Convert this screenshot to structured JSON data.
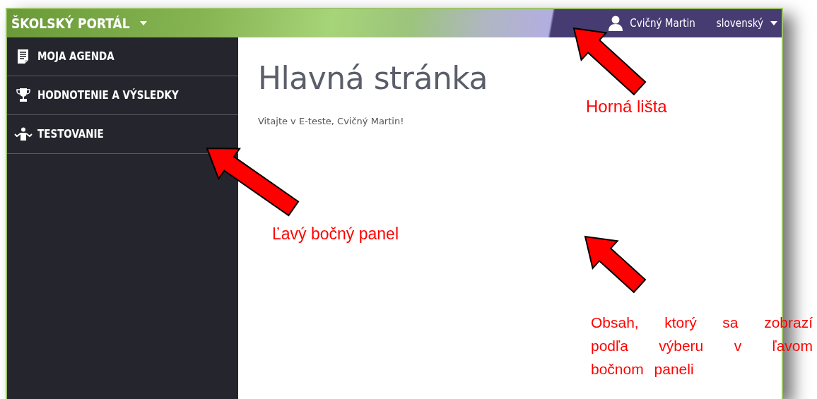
{
  "top_bar": {
    "title": "ŠKOLSKÝ PORTÁL",
    "user_name": "Cvičný Martin",
    "language": "slovenský"
  },
  "sidebar": {
    "items": [
      {
        "label": "MOJA AGENDA"
      },
      {
        "label": "HODNOTENIE A VÝSLEDKY"
      },
      {
        "label": "TESTOVANIE"
      }
    ]
  },
  "content": {
    "heading": "Hlavná stránka",
    "welcome": "Vitajte v E-teste, Cvičný Martin!"
  },
  "annotations": [
    {
      "text": "Horná lišta"
    },
    {
      "text": "Ľavý bočný panel"
    },
    {
      "text": "Obsah, ktorý sa zobrazí podľa výberu v ľavom bočnom paneli"
    }
  ]
}
